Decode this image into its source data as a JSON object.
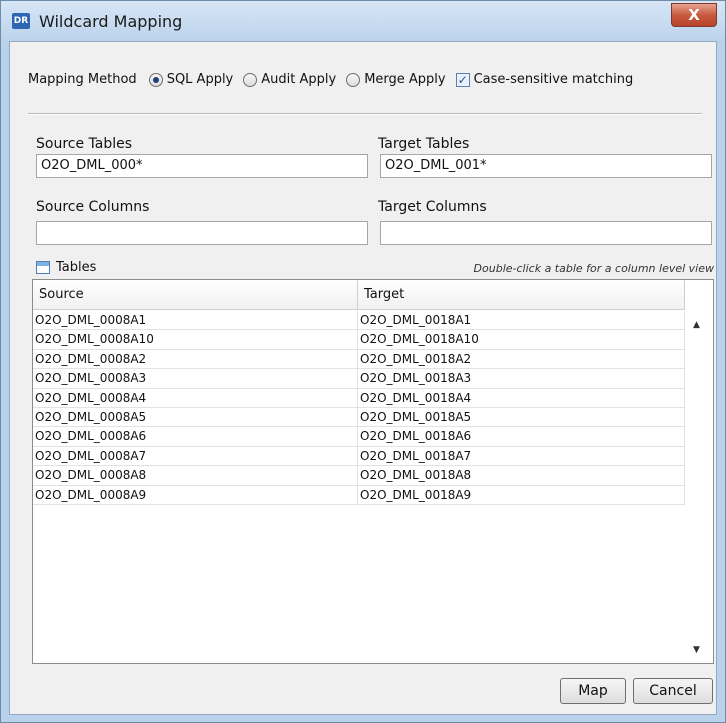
{
  "window": {
    "title": "Wildcard Mapping",
    "icon_text": "DR",
    "close_glyph": "X"
  },
  "method": {
    "label": "Mapping Method",
    "options": [
      "SQL Apply",
      "Audit Apply",
      "Merge Apply"
    ],
    "selected": "SQL Apply",
    "case_label": "Case-sensitive matching",
    "case_checked": true
  },
  "source_tables": {
    "label": "Source Tables",
    "value": "O2O_DML_000*"
  },
  "target_tables": {
    "label": "Target Tables",
    "value": "O2O_DML_001*"
  },
  "source_columns": {
    "label": "Source Columns",
    "value": ""
  },
  "target_columns": {
    "label": "Target Columns",
    "value": ""
  },
  "tables": {
    "title": "Tables",
    "hint": "Double-click a table for a column level view",
    "columns": [
      "Source",
      "Target"
    ],
    "rows": [
      [
        "O2O_DML_0008A1",
        "O2O_DML_0018A1"
      ],
      [
        "O2O_DML_0008A10",
        "O2O_DML_0018A10"
      ],
      [
        "O2O_DML_0008A2",
        "O2O_DML_0018A2"
      ],
      [
        "O2O_DML_0008A3",
        "O2O_DML_0018A3"
      ],
      [
        "O2O_DML_0008A4",
        "O2O_DML_0018A4"
      ],
      [
        "O2O_DML_0008A5",
        "O2O_DML_0018A5"
      ],
      [
        "O2O_DML_0008A6",
        "O2O_DML_0018A6"
      ],
      [
        "O2O_DML_0008A7",
        "O2O_DML_0018A7"
      ],
      [
        "O2O_DML_0008A8",
        "O2O_DML_0018A8"
      ],
      [
        "O2O_DML_0008A9",
        "O2O_DML_0018A9"
      ]
    ]
  },
  "buttons": {
    "map": "Map",
    "cancel": "Cancel"
  }
}
